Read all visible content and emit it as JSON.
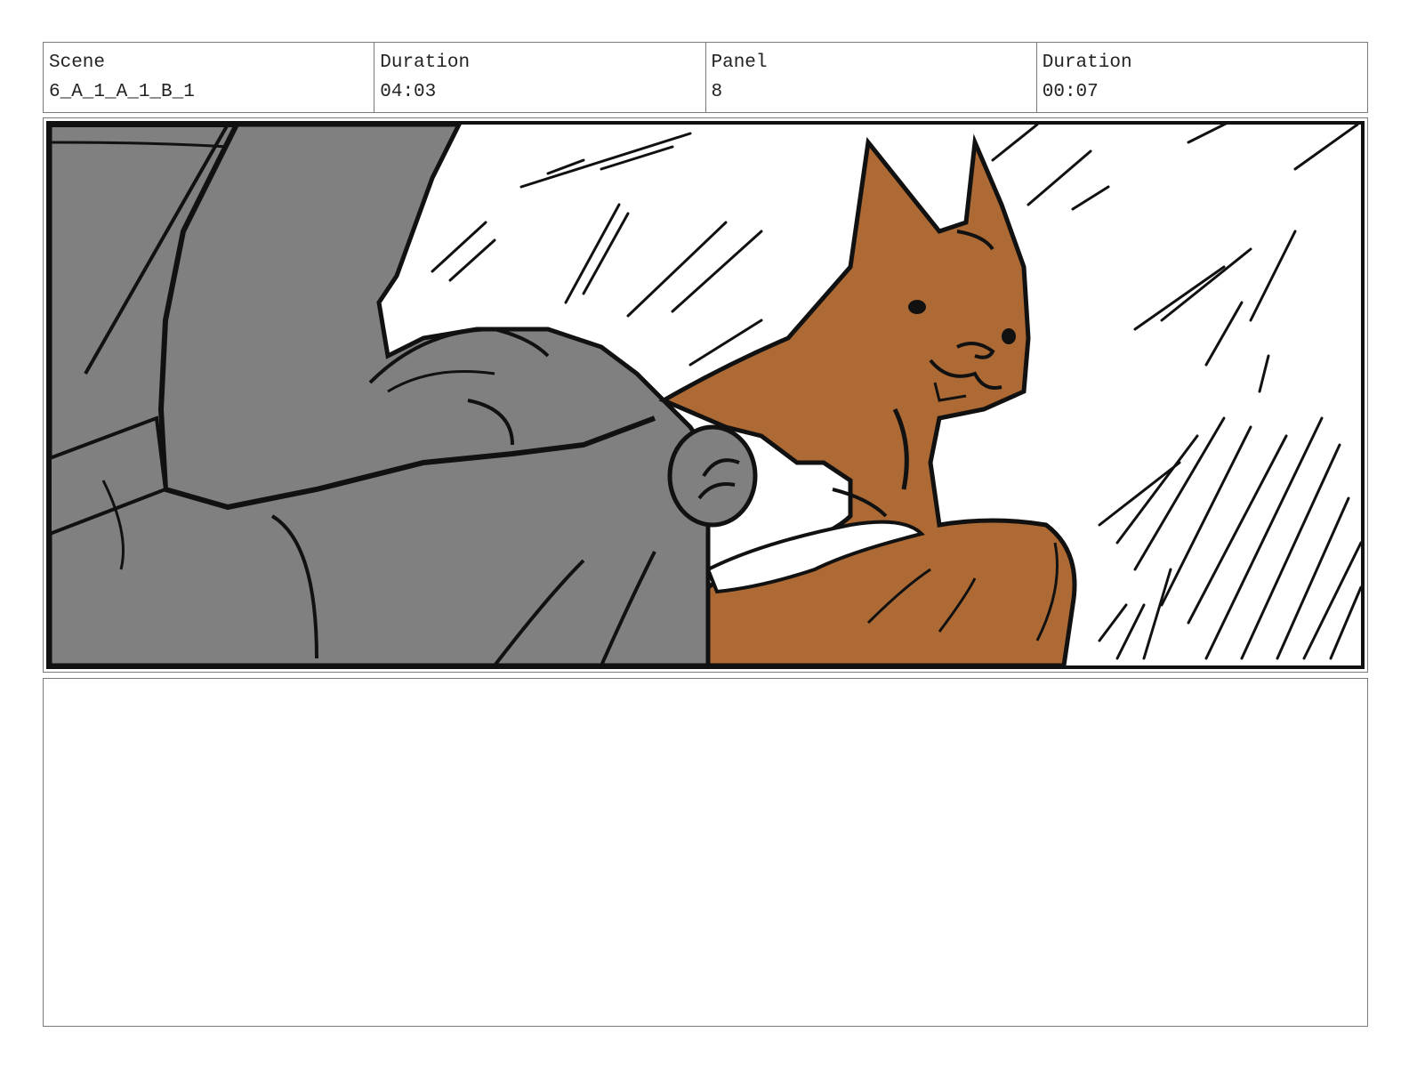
{
  "header": {
    "scene_label": "Scene",
    "scene_value": "6_A_1_A_1_B_1",
    "scene_duration_label": "Duration",
    "scene_duration_value": "04:03",
    "panel_label": "Panel",
    "panel_value": "8",
    "panel_duration_label": "Duration",
    "panel_duration_value": "00:07"
  },
  "artwork": {
    "colors": {
      "ink": "#111111",
      "gray": "#808080",
      "fox": "#ad6a35",
      "paper": "#ffffff"
    }
  },
  "notes": {
    "text": ""
  }
}
